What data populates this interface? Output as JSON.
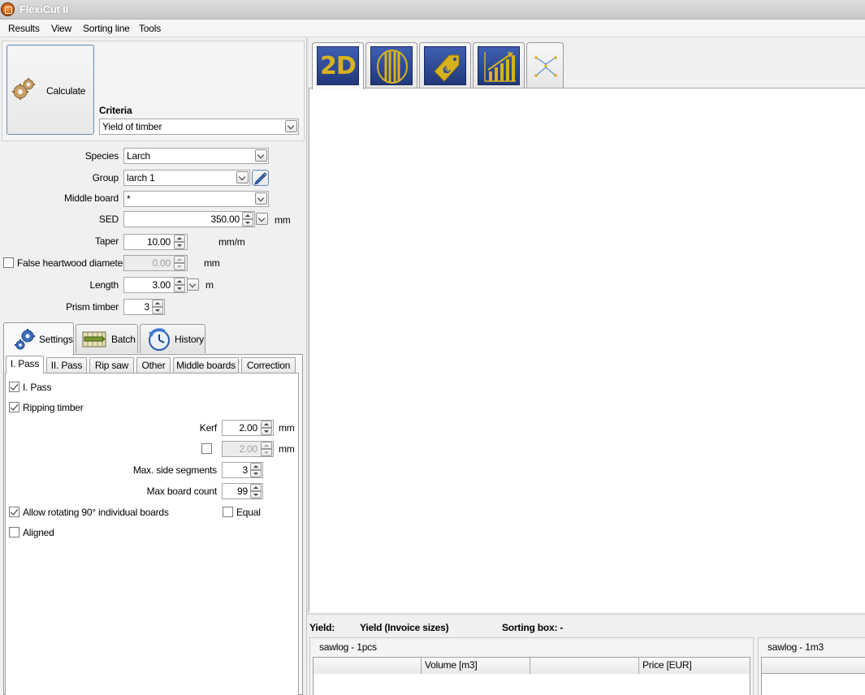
{
  "window": {
    "title": "FlexiCut II"
  },
  "menu": [
    "Results",
    "View",
    "Sorting line",
    "Tools"
  ],
  "calculate": {
    "label": "Calculate"
  },
  "criteria": {
    "label": "Criteria",
    "value": "Yield of timber"
  },
  "form": {
    "species": {
      "label": "Species",
      "value": "Larch"
    },
    "group": {
      "label": "Group",
      "value": "larch 1"
    },
    "middle_board": {
      "label": "Middle board",
      "value": "*"
    },
    "sed": {
      "label": "SED",
      "value": "350.00",
      "unit": "mm"
    },
    "taper": {
      "label": "Taper",
      "value": "10.00",
      "unit": "mm/m"
    },
    "false_heartwood": {
      "label": "False heartwood diameter",
      "value": "0.00",
      "unit": "mm",
      "checked": false
    },
    "length": {
      "label": "Length",
      "value": "3.00",
      "unit": "m"
    },
    "prism_timber": {
      "label": "Prism timber",
      "value": "3"
    }
  },
  "main_tabs": [
    {
      "label": "Settings",
      "icon": "gears-icon",
      "active": true
    },
    {
      "label": "Batch",
      "icon": "conveyor-icon",
      "active": false
    },
    {
      "label": "History",
      "icon": "history-icon",
      "active": false
    }
  ],
  "sub_tabs": [
    {
      "label": "I. Pass",
      "active": true
    },
    {
      "label": "II. Pass",
      "active": false
    },
    {
      "label": "Rip saw",
      "active": false
    },
    {
      "label": "Other",
      "active": false
    },
    {
      "label": "Middle boards",
      "active": false
    },
    {
      "label": "Correction",
      "active": false
    }
  ],
  "pass": {
    "pass_cb": {
      "label": "I. Pass",
      "checked": true
    },
    "ripping_cb": {
      "label": "Ripping timber",
      "checked": true
    },
    "kerf": {
      "label": "Kerf",
      "value": "2.00",
      "unit": "mm"
    },
    "kerf2": {
      "value": "2.00",
      "unit": "mm",
      "checked": false
    },
    "max_side_segments": {
      "label": "Max. side segments",
      "value": "3"
    },
    "max_board_count": {
      "label": "Max board count",
      "value": "99"
    },
    "rotate_cb": {
      "label": "Allow rotating 90° individual boards",
      "checked": true
    },
    "equal_cb": {
      "label": "Equal",
      "checked": false
    },
    "aligned_cb": {
      "label": "Aligned",
      "checked": false
    }
  },
  "view_tabs": [
    {
      "name": "2d-view-tab",
      "label": "2D",
      "active": true
    },
    {
      "name": "cross-section-tab",
      "icon": "log-section-icon",
      "active": false
    },
    {
      "name": "price-tab",
      "icon": "euro-tag-icon",
      "active": false
    },
    {
      "name": "statistics-tab",
      "icon": "bar-chart-icon",
      "active": false
    },
    {
      "name": "flow-tab",
      "icon": "flow-icon",
      "active": false
    }
  ],
  "status": {
    "yield_label": "Yield:",
    "yield_invoice": "Yield (Invoice sizes)",
    "sorting_box": "Sorting box: -"
  },
  "grid1": {
    "title": "sawlog - 1pcs",
    "columns": [
      "",
      "Volume [m3]",
      "",
      "Price [EUR]"
    ]
  },
  "grid2": {
    "title": "sawlog - 1m3"
  },
  "colors": {
    "tile_blue": "#2f4b9a",
    "tile_gold": "#d8b21e"
  }
}
